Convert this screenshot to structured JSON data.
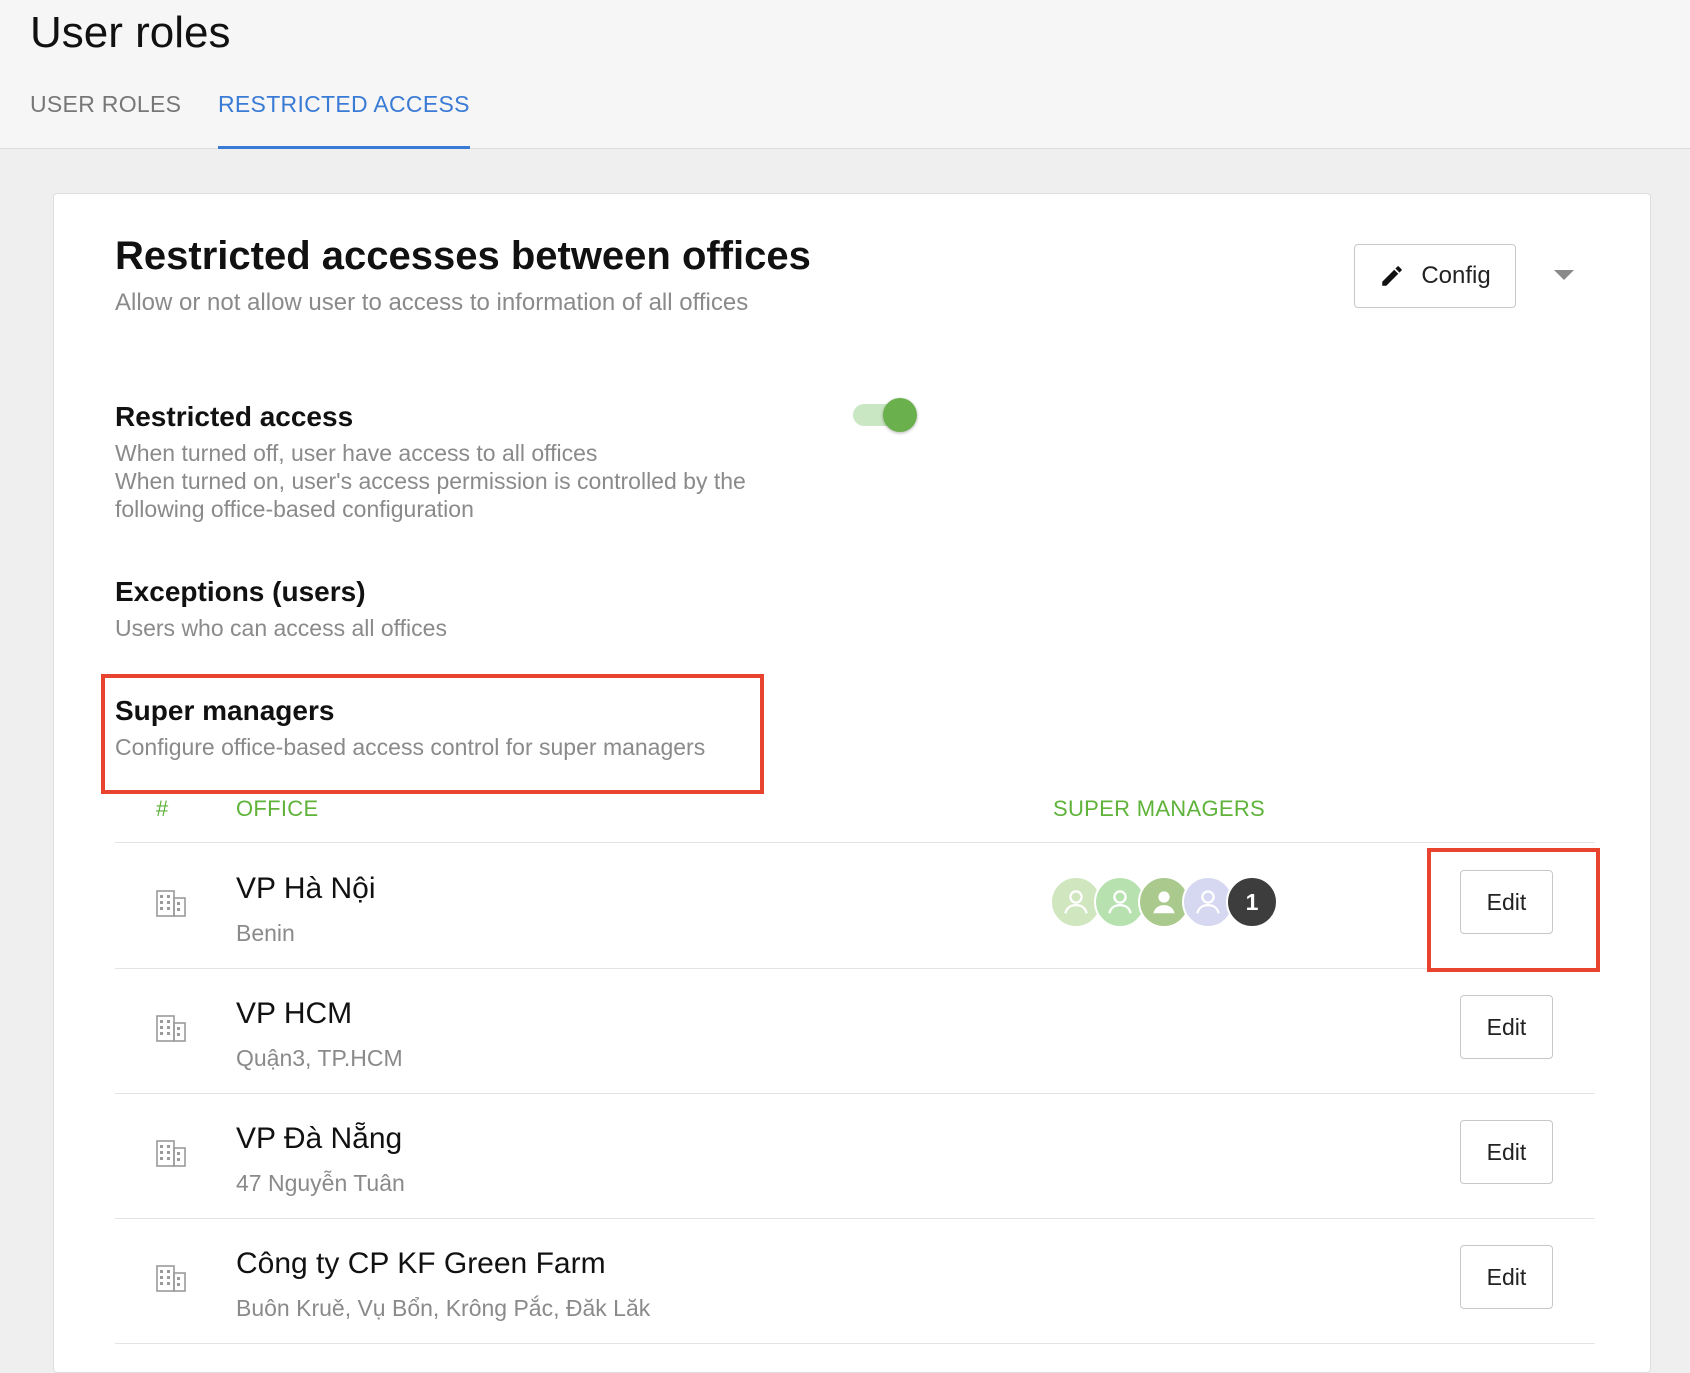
{
  "page": {
    "title": "User roles",
    "tabs": [
      {
        "label": "USER ROLES",
        "active": false
      },
      {
        "label": "RESTRICTED ACCESS",
        "active": true
      }
    ]
  },
  "card": {
    "title": "Restricted accesses between offices",
    "subtitle": "Allow or not allow user to access to information of all offices",
    "config_label": "Config"
  },
  "restricted_access": {
    "title": "Restricted access",
    "desc_line1": "When turned off, user have access to all offices",
    "desc_line2": "When turned on, user's access permission is controlled by the",
    "desc_line3": "following office-based configuration",
    "toggle_on": true
  },
  "exceptions": {
    "title": "Exceptions (users)",
    "desc": "Users who can access all offices"
  },
  "super_managers": {
    "title": "Super managers",
    "desc": "Configure office-based access control for super managers"
  },
  "table": {
    "columns": {
      "num": "#",
      "office": "OFFICE",
      "managers": "SUPER MANAGERS"
    },
    "rows": [
      {
        "name": "VP Hà Nội",
        "address": "Benin",
        "edit_label": "Edit",
        "extra_count": "1"
      },
      {
        "name": "VP HCM",
        "address": "Quận3, TP.HCM",
        "edit_label": "Edit"
      },
      {
        "name": "VP Đà Nẵng",
        "address": "47 Nguyễn Tuân",
        "edit_label": "Edit"
      },
      {
        "name": "Công ty CP KF Green Farm",
        "address": "Buôn Kruě, Vụ Bổn, Krông Pắc, Đăk Lăk",
        "edit_label": "Edit"
      }
    ]
  },
  "colors": {
    "accent_blue": "#3a7bd5",
    "accent_green": "#5fb33a",
    "toggle_green": "#6ab04c",
    "highlight_red": "#e8432f"
  }
}
